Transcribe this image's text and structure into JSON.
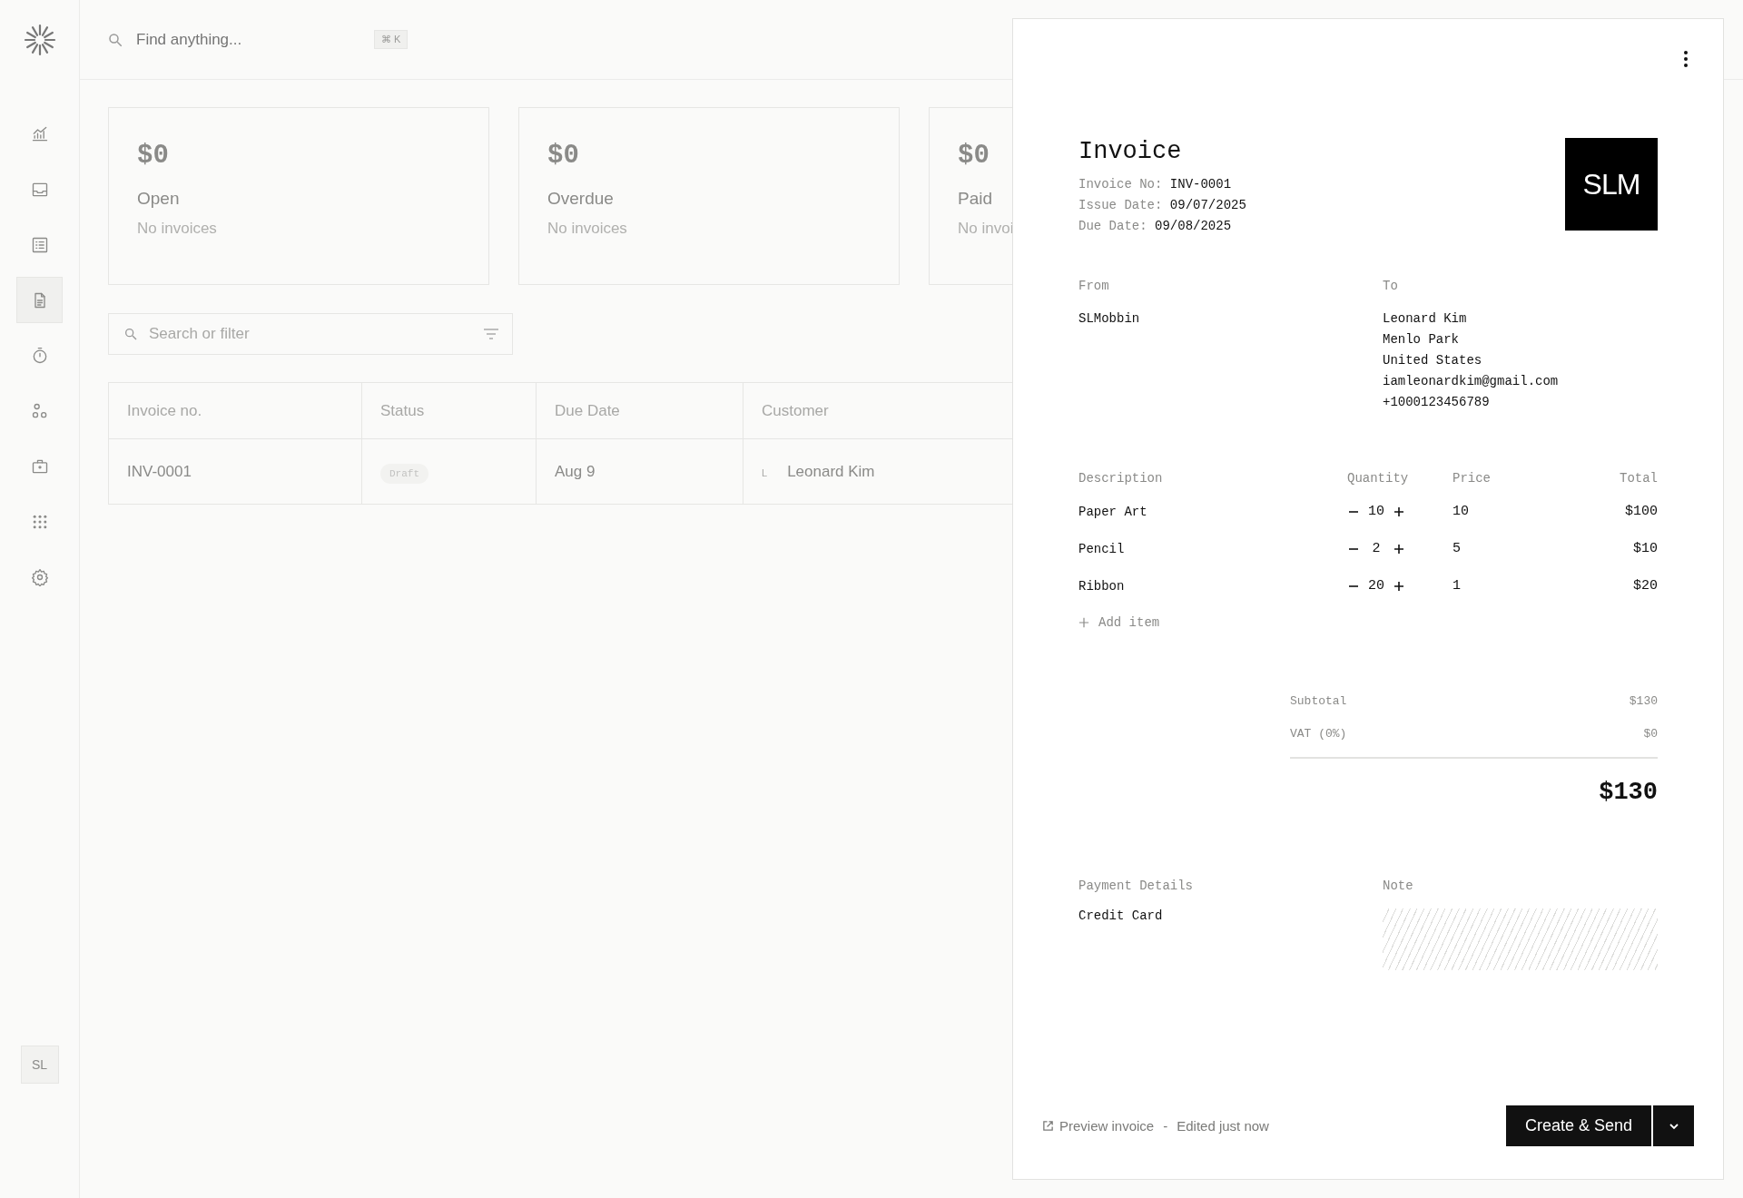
{
  "search": {
    "placeholder": "Find anything...",
    "shortcut": "⌘ K"
  },
  "sidebar": {
    "items": [
      {
        "kind": "chart",
        "selected": false
      },
      {
        "kind": "inbox",
        "selected": false
      },
      {
        "kind": "list",
        "selected": false
      },
      {
        "kind": "document",
        "selected": true
      },
      {
        "kind": "timer",
        "selected": false
      },
      {
        "kind": "people",
        "selected": false
      },
      {
        "kind": "vault",
        "selected": false
      },
      {
        "kind": "apps",
        "selected": false
      },
      {
        "kind": "settings",
        "selected": false
      }
    ],
    "avatar": "SL"
  },
  "summary_cards": [
    {
      "amount": "$0",
      "label": "Open",
      "note": "No invoices"
    },
    {
      "amount": "$0",
      "label": "Overdue",
      "note": "No invoices"
    },
    {
      "amount": "$0",
      "label": "Paid",
      "note": "No invoi"
    }
  ],
  "filter": {
    "placeholder": "Search or filter"
  },
  "table": {
    "columns": [
      "Invoice no.",
      "Status",
      "Due Date",
      "Customer"
    ],
    "rows": [
      {
        "invoice_no": "INV-0001",
        "status": "Draft",
        "due_date": "Aug 9",
        "customer_initial": "L",
        "customer": "Leonard Kim"
      }
    ]
  },
  "invoice": {
    "title": "Invoice",
    "meta": [
      {
        "label": "Invoice No:",
        "value": "INV-0001"
      },
      {
        "label": "Issue Date:",
        "value": "09/07/2025"
      },
      {
        "label": "Due Date:",
        "value": "09/08/2025"
      }
    ],
    "logo_text": "SLM",
    "from": {
      "label": "From",
      "lines": [
        "SLMobbin"
      ]
    },
    "to": {
      "label": "To",
      "lines": [
        "Leonard Kim",
        "Menlo Park",
        "United States",
        "iamleonardkim@gmail.com",
        "+1000123456789"
      ]
    },
    "items": {
      "columns": [
        "Description",
        "Quantity",
        "Price",
        "Total"
      ],
      "rows": [
        {
          "description": "Paper Art",
          "quantity": "10",
          "price": "10",
          "total": "$100"
        },
        {
          "description": "Pencil",
          "quantity": "2",
          "price": "5",
          "total": "$10"
        },
        {
          "description": "Ribbon",
          "quantity": "20",
          "price": "1",
          "total": "$20"
        }
      ]
    },
    "add_item": "Add item",
    "summary": [
      {
        "label": "Subtotal",
        "value": "$130"
      },
      {
        "label": "VAT (0%)",
        "value": "$0"
      }
    ],
    "total": "$130",
    "payment": {
      "label": "Payment Details",
      "value": "Credit Card"
    },
    "note": {
      "label": "Note"
    },
    "footer": {
      "preview": "Preview invoice",
      "separator": "-",
      "edited": "Edited just now"
    },
    "primary_button": "Create & Send"
  }
}
